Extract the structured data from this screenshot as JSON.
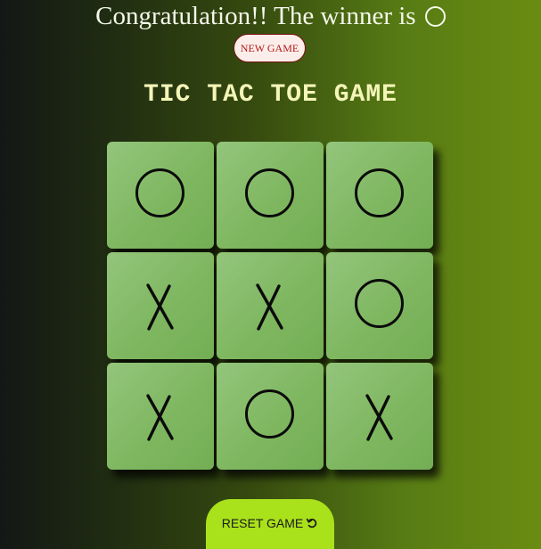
{
  "header": {
    "winner_text": "Congratulation!! The winner is",
    "winner_symbol": "circle-icon",
    "new_game_label": "NEW GAME"
  },
  "title": "TIC TAC TOE GAME",
  "board": {
    "cells": [
      "O",
      "O",
      "O",
      "X",
      "X",
      "O",
      "X",
      "O",
      "X"
    ]
  },
  "reset": {
    "label": "RESET GAME",
    "icon": "refresh-icon"
  },
  "colors": {
    "accent": "#a9e11b",
    "cell": "#82ba66",
    "title": "#f4f5b8",
    "new_game_text": "#b61818"
  }
}
